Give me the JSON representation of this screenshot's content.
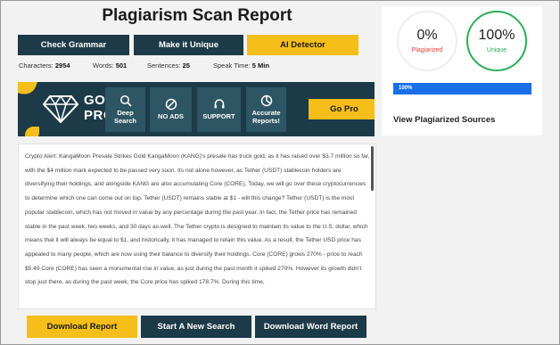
{
  "page": {
    "title": "Plagiarism Scan Report"
  },
  "toolbar": {
    "check_grammar": "Check Grammar",
    "make_unique": "Make it Unique",
    "ai_detector": "AI Detector"
  },
  "stats": {
    "characters_label": "Characters:",
    "characters_value": "2954",
    "words_label": "Words:",
    "words_value": "501",
    "sentences_label": "Sentences:",
    "sentences_value": "25",
    "speak_label": "Speak Time:",
    "speak_value": "5 Min"
  },
  "promo": {
    "go": "GO",
    "pro": "PRO",
    "features": [
      {
        "label": "Deep Search",
        "icon": "search-icon"
      },
      {
        "label": "NO ADS",
        "icon": "no-ads-icon"
      },
      {
        "label": "SUPPORT",
        "icon": "headset-icon"
      },
      {
        "label": "Accurate Reports!",
        "icon": "pie-chart-icon"
      }
    ],
    "cta": "Go Pro"
  },
  "content": {
    "text": "Crypto Alert: KangaMoon Presale Strikes Gold KangaMoon (KANG)'s presale has truck gold, as it has raised over $3.7 million so far, with the $4 million mark expected to be passed very soon. Its not alone however, as Tether (USDT) stablecoin holders are diversifying their holdings, and alongside KANG are also accumulating Core (CORE). Today, we will go over these cryptocurrencies to determine which one can come out on top. Tether (USDT) remains stable at $1 - will this change? Tether (USDT) is the most popular stablecoin, which has not moved in value by any percentage during the past year. In fact, the Tether price has remained stable in the past week, two weeks, and 30 days as-well. The Tether crypto is designed to maintain its value to the U.S. dollar, which means that it will always be equal to $1, and historically, it has managed to retain this value. As a result, the Tether USD price has appealed to many people, which are now using their balance to diversify their holdings. Core (CORE) grows 270% - price to reach $5.49 Core (CORE) has seen a monumental rise in value, as just during the past month it spiked 270%. However its growth didn't stop just there, as during the past week, the Core price has spiked 178.7%. During this time,"
  },
  "actions": {
    "download_report": "Download Report",
    "new_search": "Start A New Search",
    "download_word": "Download Word Report"
  },
  "results": {
    "plagiarized_value": "0%",
    "plagiarized_label": "Plagiarized",
    "plagiarized_fraction": 0,
    "unique_value": "100%",
    "unique_label": "Unique",
    "unique_fraction": 1,
    "progress_label": "100%",
    "progress_fraction": 1,
    "view_sources": "View Plagiarized Sources",
    "colors": {
      "plagiarized": "#e0443b",
      "unique": "#2fae57",
      "progress": "#1a6fe8"
    }
  },
  "colors": {
    "dark": "#1c3a48",
    "accent": "#f5be1a"
  }
}
